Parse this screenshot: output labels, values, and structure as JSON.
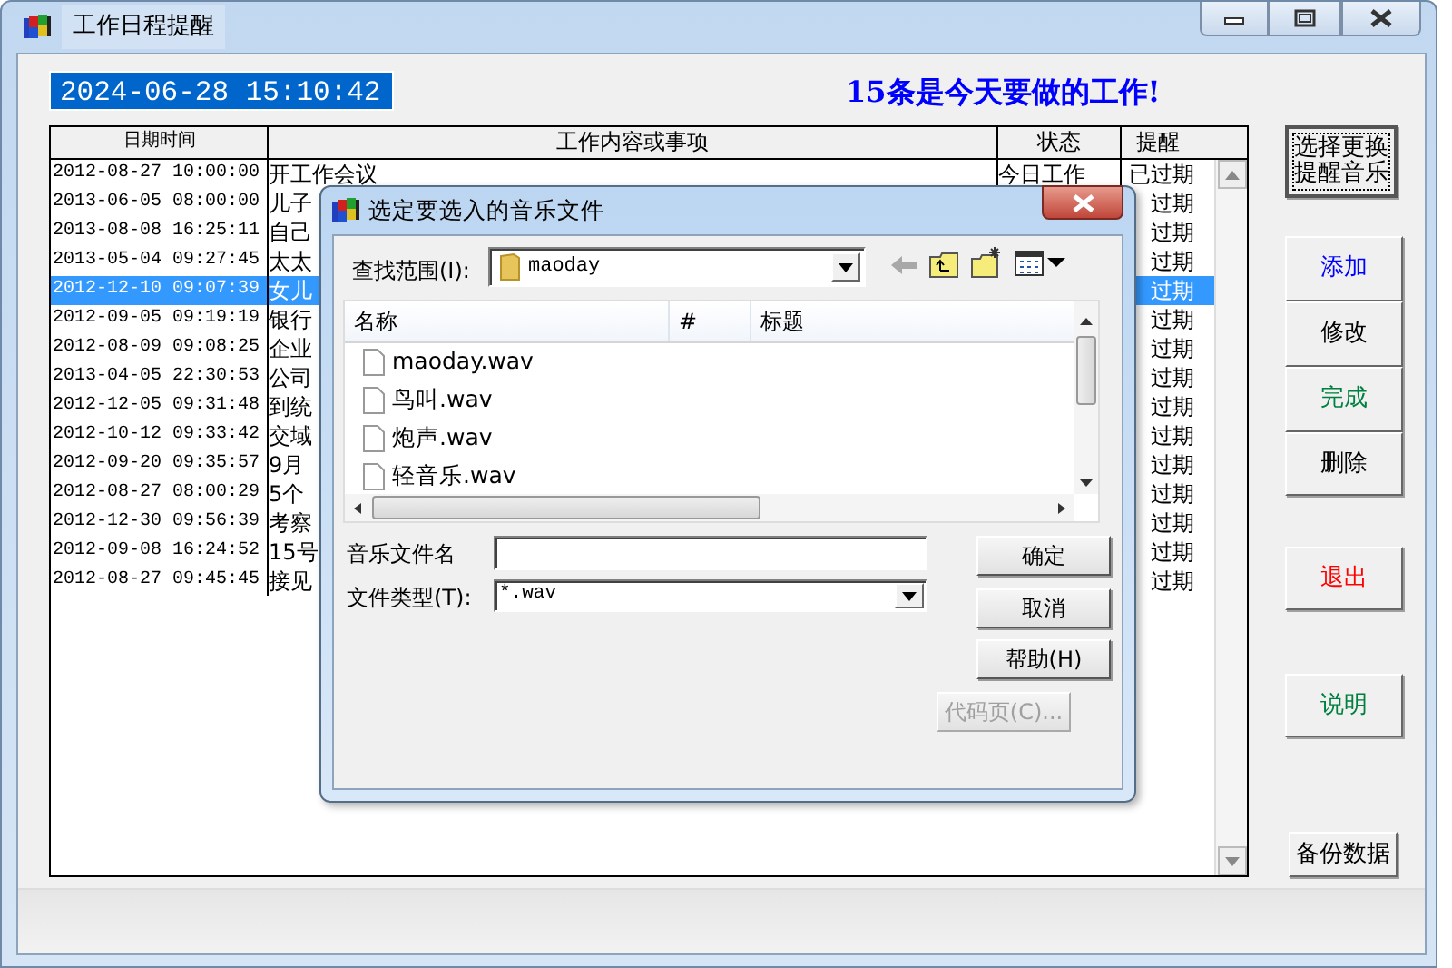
{
  "window": {
    "title": "工作日程提醒"
  },
  "clock": "2024-06-28 15:10:42",
  "headline": "15条是今天要做的工作!",
  "table": {
    "columns": [
      "日期时间",
      "工作内容或事项",
      "状态",
      "提醒"
    ],
    "rows": [
      {
        "date": "2012-08-27 10:00:00",
        "content": "开工作会议",
        "status": "今日工作",
        "reminder": "已过期",
        "selected": false
      },
      {
        "date": "2013-06-05 08:00:00",
        "content": "儿子",
        "reminder": "过期",
        "selected": false
      },
      {
        "date": "2013-08-08 16:25:11",
        "content": "自己",
        "reminder": "过期",
        "selected": false
      },
      {
        "date": "2013-05-04 09:27:45",
        "content": "太太",
        "reminder": "过期",
        "selected": false
      },
      {
        "date": "2012-12-10 09:07:39",
        "content": "女儿",
        "reminder": "过期",
        "selected": true
      },
      {
        "date": "2012-09-05 09:19:19",
        "content": "银行",
        "reminder": "过期",
        "selected": false
      },
      {
        "date": "2012-08-09 09:08:25",
        "content": "企业",
        "reminder": "过期",
        "selected": false
      },
      {
        "date": "2013-04-05 22:30:53",
        "content": "公司",
        "reminder": "过期",
        "selected": false
      },
      {
        "date": "2012-12-05 09:31:48",
        "content": "到统",
        "reminder": "过期",
        "selected": false
      },
      {
        "date": "2012-10-12 09:33:42",
        "content": "交域",
        "reminder": "过期",
        "selected": false
      },
      {
        "date": "2012-09-20 09:35:57",
        "content": "9月",
        "reminder": "过期",
        "selected": false
      },
      {
        "date": "2012-08-27 08:00:29",
        "content": "5个",
        "reminder": "过期",
        "selected": false
      },
      {
        "date": "2012-12-30 09:56:39",
        "content": "考察",
        "reminder": "过期",
        "selected": false
      },
      {
        "date": "2012-09-08 16:24:52",
        "content": "15号",
        "reminder": "过期",
        "selected": false
      },
      {
        "date": "2012-08-27 09:45:45",
        "content": "接见",
        "reminder": "过期",
        "selected": false
      }
    ]
  },
  "buttons": [
    {
      "label": "选择更换提醒音乐",
      "color": "#000000",
      "focused": true
    },
    {
      "label": "添加",
      "color": "#0000ff",
      "focused": false
    },
    {
      "label": "修改",
      "color": "#000000",
      "focused": false
    },
    {
      "label": "完成",
      "color": "#008040",
      "focused": false
    },
    {
      "label": "删除",
      "color": "#000000",
      "focused": false
    },
    {
      "label": "退出",
      "color": "#ff0000",
      "focused": false
    },
    {
      "label": "说明",
      "color": "#008040",
      "focused": false
    },
    {
      "label": "备份数据",
      "color": "#000000",
      "focused": false
    }
  ],
  "dialog": {
    "title": "选定要选入的音乐文件",
    "look_in_label": "查找范围(I):",
    "look_in_value": "maoday",
    "columns": [
      "名称",
      "#",
      "标题"
    ],
    "files": [
      "maoday.wav",
      "鸟叫.wav",
      "炮声.wav",
      "轻音乐.wav"
    ],
    "file_name_label": "音乐文件名",
    "file_type_label": "文件类型(T):",
    "file_type_value": "*.wav",
    "buttons": [
      {
        "label": "确定",
        "disabled": false
      },
      {
        "label": "取消",
        "disabled": false
      },
      {
        "label": "帮助(H)",
        "disabled": false
      },
      {
        "label": "代码页(C)...",
        "disabled": true
      }
    ]
  }
}
